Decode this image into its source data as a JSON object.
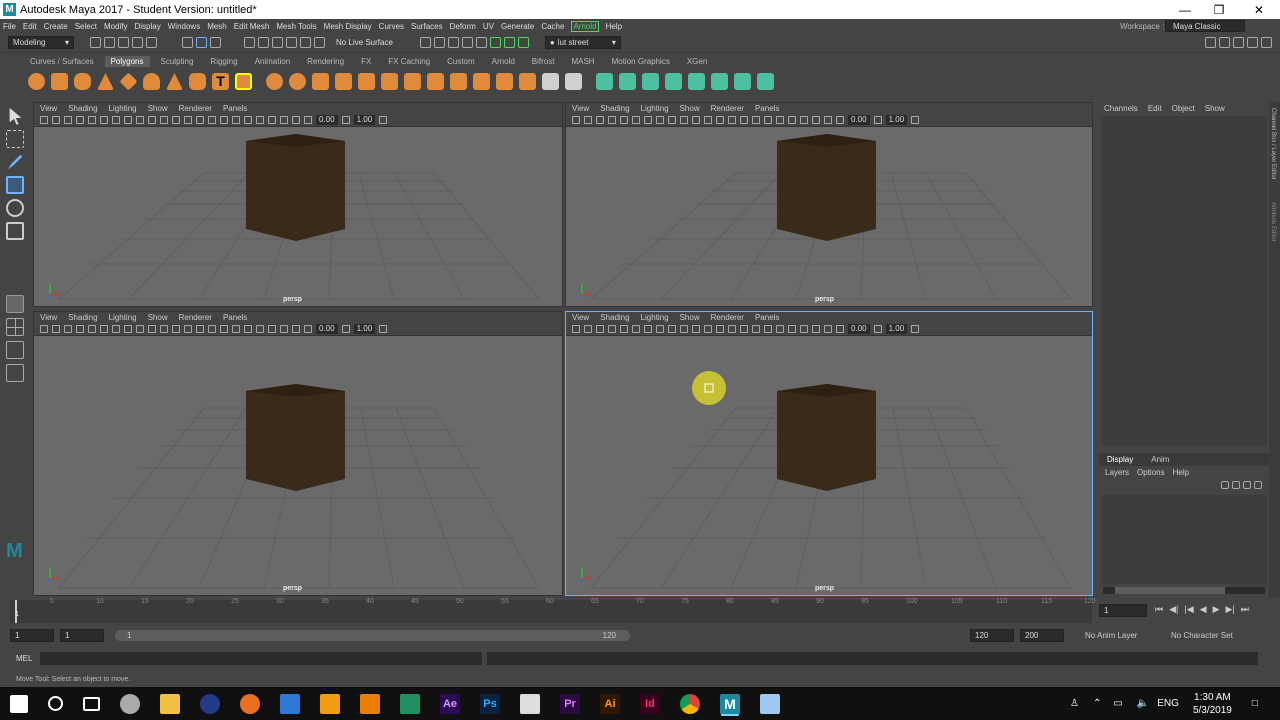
{
  "window": {
    "title": "Autodesk Maya 2017 - Student Version: untitled*"
  },
  "menus": [
    "File",
    "Edit",
    "Create",
    "Select",
    "Modify",
    "Display",
    "Windows",
    "Mesh",
    "Edit Mesh",
    "Mesh Tools",
    "Mesh Display",
    "Curves",
    "Surfaces",
    "Deform",
    "UV",
    "Generate",
    "Cache",
    "Arnold",
    "Help"
  ],
  "workspace": {
    "label": "Workspace :",
    "value": "Maya Classic"
  },
  "statusline": {
    "menuset": "Modeling",
    "live_surface": "No Live Surface",
    "user": "lut street"
  },
  "shelf": {
    "tabs": [
      "Curves / Surfaces",
      "Polygons",
      "Sculpting",
      "Rigging",
      "Animation",
      "Rendering",
      "FX",
      "FX Caching",
      "Custom",
      "Arnold",
      "Bifrost",
      "MASH",
      "Motion Graphics",
      "XGen"
    ],
    "active_tab": "Polygons"
  },
  "viewport": {
    "menu": [
      "View",
      "Shading",
      "Lighting",
      "Show",
      "Renderer",
      "Panels"
    ],
    "field1": "0.00",
    "field2": "1.00",
    "camera": "persp"
  },
  "channelbox": {
    "menu": [
      "Channels",
      "Edit",
      "Object",
      "Show"
    ]
  },
  "layers": {
    "tabs": [
      "Display",
      "Anim"
    ],
    "menu": [
      "Layers",
      "Options",
      "Help"
    ]
  },
  "sidebar": {
    "label1": "Channel Box / Layer Editor",
    "label2": "Attribute Editor"
  },
  "timeline": {
    "ticks": [
      "1",
      "5",
      "10",
      "15",
      "20",
      "25",
      "30",
      "35",
      "40",
      "45",
      "50",
      "55",
      "60",
      "65",
      "70",
      "75",
      "80",
      "85",
      "90",
      "95",
      "100",
      "105",
      "110",
      "115",
      "120"
    ],
    "current_frame": "1"
  },
  "range": {
    "start": "1",
    "playback_start": "1",
    "slider_start": "1",
    "slider_end": "120",
    "playback_end": "120",
    "end": "200",
    "anim_layer": "No Anim Layer",
    "char_set": "No Character Set"
  },
  "cmdline": {
    "label": "MEL"
  },
  "help": {
    "text": "Move Tool: Select an object to move."
  },
  "taskbar": {
    "lang": "ENG",
    "time": "1:30 AM",
    "date": "5/3/2019"
  },
  "colors": {
    "accent": "#4cd964",
    "viewport_bg": "#6a6a6a",
    "cube": "#3a2a1a"
  }
}
